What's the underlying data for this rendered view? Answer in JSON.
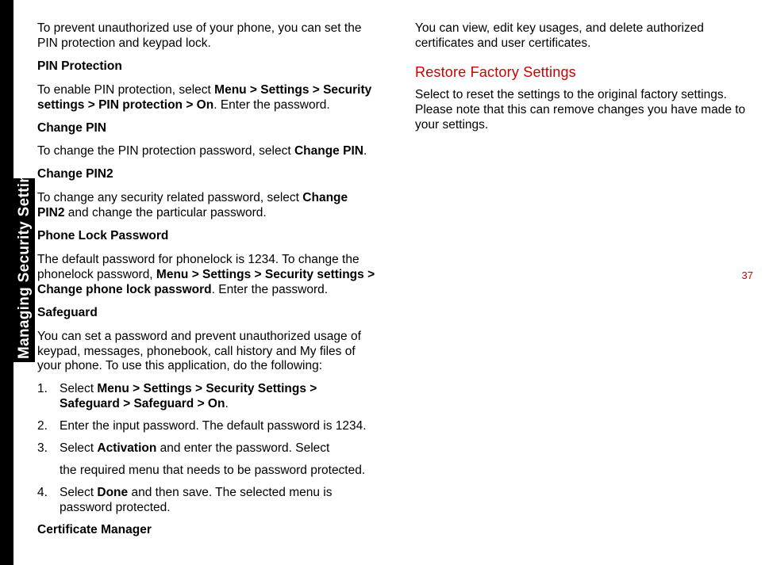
{
  "sidebar": {
    "tab_label": "Managing Security Settings"
  },
  "page_number": "37",
  "left_col": {
    "intro": "To prevent unauthorized use of your phone, you can set the PIN protection and keypad lock.",
    "pin_protection_head": "PIN Protection",
    "pin_protection_body_pre": "To enable PIN protection, select ",
    "pin_protection_body_bold": "Menu > Settings > Security settings > PIN protection > On",
    "pin_protection_body_post": ". Enter the password.",
    "change_pin_head": "Change PIN",
    "change_pin_body_pre": "To change the PIN protection password, select ",
    "change_pin_body_bold": "Change PIN",
    "change_pin_body_post": ".",
    "change_pin2_head": "Change PIN2",
    "change_pin2_body_pre": "To change any security related password, select ",
    "change_pin2_body_bold": "Change PIN2",
    "change_pin2_body_post": " and change the particular password.",
    "phonelock_head": "Phone Lock Password",
    "phonelock_body_pre": "The default password for phonelock is 1234. To change the phonelock password, ",
    "phonelock_body_bold": "Menu > Settings > Security settings > Change phone lock password",
    "phonelock_body_post": ". Enter the password.",
    "safeguard_head": "Safeguard",
    "safeguard_intro": "You can set a password and prevent unauthorized usage of keypad, messages, phonebook, call history and My files of your phone. To use this application, do the following:",
    "safeguard_steps": {
      "s1_num": "1.",
      "s1_pre": "Select ",
      "s1_bold": "Menu > Settings > Security Settings > Safeguard > Safeguard > On",
      "s1_post": ".",
      "s2_num": "2.",
      "s2_text": "Enter the input password. The default password is 1234.",
      "s3_num": "3.",
      "s3_pre": "Select ",
      "s3_bold": "Activation",
      "s3_post": " and enter the password. Select"
    }
  },
  "right_col": {
    "cont_text": "the required menu that needs to be password protected.",
    "s4_num": "4.",
    "s4_pre": "Select ",
    "s4_bold": "Done",
    "s4_post": " and then save. The selected menu is password protected.",
    "cert_head": "Certificate Manager",
    "cert_body": "You can view, edit key usages, and delete authorized certificates and user certificates.",
    "restore_title": "Restore Factory Settings",
    "restore_body": "Select to reset the settings to the original factory settings. Please note that this can remove changes you have made to your settings."
  }
}
